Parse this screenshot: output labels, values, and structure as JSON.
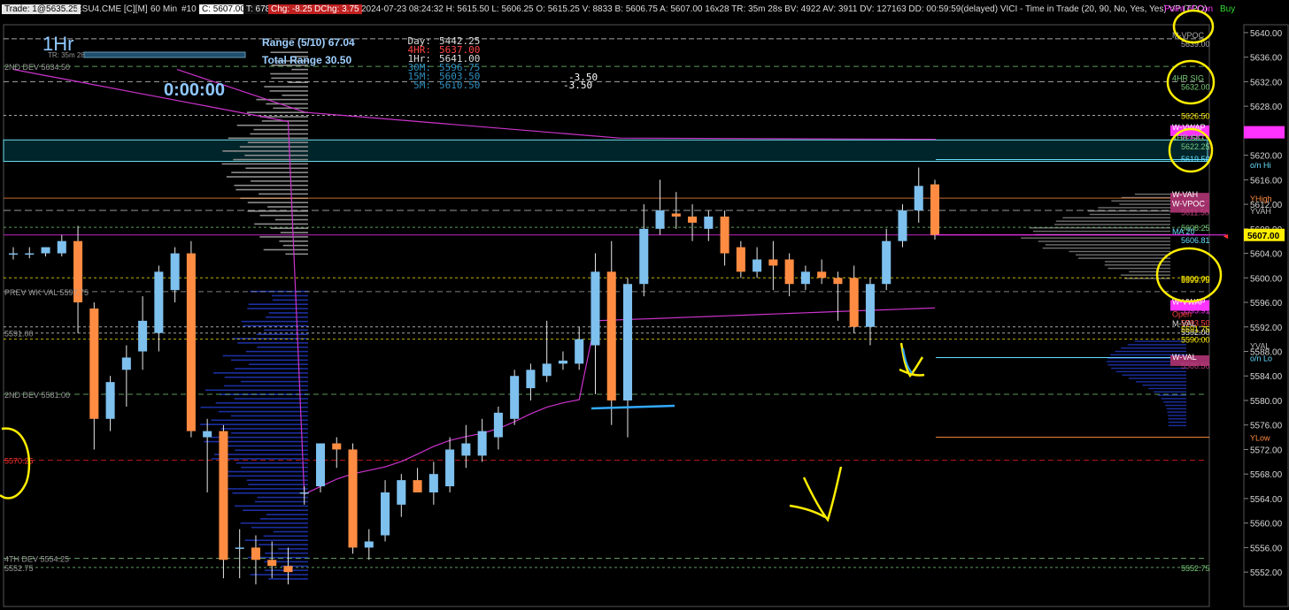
{
  "toolbar": {
    "trade_label": "Trade: 1@5635.25",
    "symbol": "ESU4.CME [C][M]",
    "interval": "60 Min",
    "bar_no": "#10",
    "close_chip": "C: 5607.00",
    "ticks": "T: 6783",
    "chg": "Chg: -8.25",
    "dchg": "DChg: 3.75",
    "info": "2024-07-23 08:24:32 H: 5615.50 L: 5606.25 O: 5615.25 V: 8833 B: 5606.75 A: 5607.00 16x28 TR: 35m 28s BV: 4922 AV: 3911 DV: 127163 DD: 00:59:59(delayed) VICI - Time in Trade (20, 90, No, Yes, Yes) VP (TPO)",
    "poi": "Point of Con",
    "buy": "Buy"
  },
  "panel": {
    "timeframe": "1Hr",
    "tr_label": "TR: 35m 28s",
    "countdown": "0:00:00",
    "range": "Range (5/10) 67.04",
    "total_range": "Total Range 30.50",
    "day": "Day:",
    "day_v": "5442.25",
    "h4": "4HR:",
    "h4_v": "5637.00",
    "h1": "1Hr:",
    "h1_v": "5641.00",
    "m30": "30M:",
    "m30_v": "5596.75",
    "m15": "15M:",
    "m15_v": "5603.50",
    "m5": "5M:",
    "m5_v": "5610.50",
    "delta1": "-3.50",
    "delta2": "-3.50"
  },
  "colors": {
    "up": "#7ec0ee",
    "down": "#ff8c42",
    "magenta": "#ff33ff",
    "annotation": "#ffee00",
    "green": "#7ccd7c"
  },
  "chart_data": {
    "type": "candlestick",
    "ylim": [
      5550,
      5641
    ],
    "y_ticks": [
      5640,
      5636,
      5632,
      5628,
      5624,
      5620,
      5616,
      5612,
      5608,
      5604,
      5600,
      5596,
      5592,
      5588,
      5584,
      5580,
      5576,
      5572,
      5568,
      5564,
      5560,
      5556,
      5552
    ],
    "y_tick_labels": [
      "5640.00",
      "5636.00",
      "5632.00",
      "5628.00",
      "5624.00",
      "5620.00",
      "5616.00",
      "5612.00",
      "5608.00",
      "5604.00",
      "5600.00",
      "5596.00",
      "5592.00",
      "5588.00",
      "5584.00",
      "5580.00",
      "5576.00",
      "5572.00",
      "5568.00",
      "5564.00",
      "5560.00",
      "5556.00",
      "5552.00"
    ],
    "last_price": "5607.00",
    "candles": [
      {
        "o": 5604.0,
        "h": 5605.0,
        "l": 5603.0,
        "c": 5604.0
      },
      {
        "o": 5604.0,
        "h": 5605.0,
        "l": 5603.2,
        "c": 5604.0
      },
      {
        "o": 5604.0,
        "h": 5605.0,
        "l": 5603.5,
        "c": 5605.0
      },
      {
        "o": 5604.0,
        "h": 5607.0,
        "l": 5603.5,
        "c": 5606.0
      },
      {
        "o": 5606.0,
        "h": 5608.5,
        "l": 5591.0,
        "c": 5596.0
      },
      {
        "o": 5595.0,
        "h": 5596.0,
        "l": 5572.0,
        "c": 5577.0
      },
      {
        "o": 5577.0,
        "h": 5584.0,
        "l": 5575.0,
        "c": 5583.0
      },
      {
        "o": 5585.0,
        "h": 5589.0,
        "l": 5579.0,
        "c": 5587.0
      },
      {
        "o": 5588.0,
        "h": 5597.0,
        "l": 5585.0,
        "c": 5593.0
      },
      {
        "o": 5591.0,
        "h": 5602.0,
        "l": 5588.0,
        "c": 5601.0
      },
      {
        "o": 5598.0,
        "h": 5605.0,
        "l": 5596.0,
        "c": 5604.0
      },
      {
        "o": 5604.0,
        "h": 5606.0,
        "l": 5574.0,
        "c": 5575.0
      },
      {
        "o": 5574.0,
        "h": 5577.0,
        "l": 5565.0,
        "c": 5575.0
      },
      {
        "o": 5575.0,
        "h": 5576.0,
        "l": 5551.0,
        "c": 5554.0
      },
      {
        "o": 5556.0,
        "h": 5559.0,
        "l": 5551.0,
        "c": 5556.0
      },
      {
        "o": 5556.0,
        "h": 5558.0,
        "l": 5550.0,
        "c": 5554.0
      },
      {
        "o": 5554.0,
        "h": 5557.0,
        "l": 5551.0,
        "c": 5553.0
      },
      {
        "o": 5553.0,
        "h": 5556.0,
        "l": 5550.0,
        "c": 5552.0
      },
      {
        "o": 5565.0,
        "h": 5566.0,
        "l": 5563.0,
        "c": 5565.0
      },
      {
        "o": 5566.0,
        "h": 5573.0,
        "l": 5565.0,
        "c": 5573.0
      },
      {
        "o": 5573.0,
        "h": 5574.0,
        "l": 5569.0,
        "c": 5572.0
      },
      {
        "o": 5572.0,
        "h": 5573.0,
        "l": 5555.0,
        "c": 5556.0
      },
      {
        "o": 5556.0,
        "h": 5559.0,
        "l": 5554.0,
        "c": 5557.0
      },
      {
        "o": 5558.0,
        "h": 5567.0,
        "l": 5557.0,
        "c": 5565.0
      },
      {
        "o": 5563.0,
        "h": 5568.0,
        "l": 5561.0,
        "c": 5567.0
      },
      {
        "o": 5567.0,
        "h": 5569.0,
        "l": 5565.0,
        "c": 5565.0
      },
      {
        "o": 5565.0,
        "h": 5570.0,
        "l": 5563.0,
        "c": 5568.0
      },
      {
        "o": 5566.0,
        "h": 5574.0,
        "l": 5565.0,
        "c": 5572.0
      },
      {
        "o": 5571.0,
        "h": 5576.0,
        "l": 5569.0,
        "c": 5573.0
      },
      {
        "o": 5571.0,
        "h": 5577.0,
        "l": 5570.0,
        "c": 5575.0
      },
      {
        "o": 5574.0,
        "h": 5579.0,
        "l": 5572.0,
        "c": 5578.0
      },
      {
        "o": 5577.0,
        "h": 5585.0,
        "l": 5576.0,
        "c": 5584.0
      },
      {
        "o": 5582.0,
        "h": 5586.0,
        "l": 5580.0,
        "c": 5585.0
      },
      {
        "o": 5584.0,
        "h": 5593.0,
        "l": 5583.0,
        "c": 5586.0
      },
      {
        "o": 5586.0,
        "h": 5588.0,
        "l": 5585.0,
        "c": 5586.5
      },
      {
        "o": 5586.0,
        "h": 5592.0,
        "l": 5585.0,
        "c": 5590.0
      },
      {
        "o": 5589.0,
        "h": 5604.0,
        "l": 5581.0,
        "c": 5601.0
      },
      {
        "o": 5601.0,
        "h": 5606.0,
        "l": 5576.0,
        "c": 5580.0
      },
      {
        "o": 5580.0,
        "h": 5600.0,
        "l": 5574.0,
        "c": 5599.0
      },
      {
        "o": 5599.0,
        "h": 5612.0,
        "l": 5597.0,
        "c": 5608.0
      },
      {
        "o": 5608.0,
        "h": 5616.0,
        "l": 5607.0,
        "c": 5611.0
      },
      {
        "o": 5610.5,
        "h": 5614.0,
        "l": 5608.0,
        "c": 5610.0
      },
      {
        "o": 5610.0,
        "h": 5612.0,
        "l": 5606.0,
        "c": 5609.0
      },
      {
        "o": 5608.0,
        "h": 5611.0,
        "l": 5606.0,
        "c": 5610.0
      },
      {
        "o": 5610.0,
        "h": 5611.0,
        "l": 5602.0,
        "c": 5604.0
      },
      {
        "o": 5605.0,
        "h": 5606.0,
        "l": 5600.0,
        "c": 5601.0
      },
      {
        "o": 5601.0,
        "h": 5605.0,
        "l": 5600.0,
        "c": 5603.0
      },
      {
        "o": 5603.0,
        "h": 5606.0,
        "l": 5598.0,
        "c": 5602.0
      },
      {
        "o": 5603.0,
        "h": 5604.0,
        "l": 5597.0,
        "c": 5599.0
      },
      {
        "o": 5599.0,
        "h": 5602.0,
        "l": 5598.0,
        "c": 5601.0
      },
      {
        "o": 5601.0,
        "h": 5603.0,
        "l": 5599.0,
        "c": 5600.0
      },
      {
        "o": 5600.0,
        "h": 5601.0,
        "l": 5593.0,
        "c": 5599.0
      },
      {
        "o": 5600.0,
        "h": 5602.0,
        "l": 5591.0,
        "c": 5592.0
      },
      {
        "o": 5592.0,
        "h": 5600.0,
        "l": 5589.0,
        "c": 5599.0
      },
      {
        "o": 5599.0,
        "h": 5608.0,
        "l": 5598.0,
        "c": 5606.0
      },
      {
        "o": 5606.0,
        "h": 5612.0,
        "l": 5605.0,
        "c": 5611.0
      },
      {
        "o": 5611.0,
        "h": 5618.0,
        "l": 5609.0,
        "c": 5615.0
      },
      {
        "o": 5615.25,
        "h": 5616.0,
        "l": 5606.25,
        "c": 5607.0
      }
    ],
    "levels": [
      {
        "price": 5639.0,
        "label": "M-VPOC",
        "value": "5639.00",
        "color": "#aaaaaa"
      },
      {
        "price": 5632.0,
        "label": "4HR SIG",
        "value": "5632.00",
        "color": "#7ccd7c"
      },
      {
        "price": 5626.5,
        "label": "",
        "value": "5626.50",
        "color": "#ffee00"
      },
      {
        "price": 5624.0,
        "label": "W-VWAP",
        "value": "5623.75",
        "color": "#ff33ff"
      },
      {
        "price": 5622.25,
        "label": "4HR SIG",
        "value": "5622.25",
        "color": "#7ccd7c"
      },
      {
        "price": 5619.5,
        "label": "",
        "value": "5619.50",
        "color": "#66ddff"
      },
      {
        "price": 5613.0,
        "label": "W-VAH",
        "value": "5613.00",
        "color": "#c04080"
      },
      {
        "price": 5611.5,
        "label": "W-VPOC",
        "value": "5611.50",
        "color": "#c04080"
      },
      {
        "price": 5608.25,
        "label": "",
        "value": "5608.25",
        "color": "#7ccd7c"
      },
      {
        "price": 5607.0,
        "label": "MA 20",
        "value": "5606.81",
        "color": "#66ddff"
      },
      {
        "price": 5600.0,
        "label": "",
        "value": "5600.00",
        "color": "#ffee00"
      },
      {
        "price": 5599.75,
        "label": "",
        "value": "5599.75",
        "color": "#ffee00"
      },
      {
        "price": 5595.5,
        "label": "W-VWAP",
        "value": "5595.91",
        "color": "#ff33ff"
      },
      {
        "price": 5593.5,
        "label": "Open",
        "value": "5593.50",
        "color": "#ff4444"
      },
      {
        "price": 5592.0,
        "label": "M-VAL",
        "value": "5592.00",
        "color": "#dddddd"
      },
      {
        "price": 5591.75,
        "label": "",
        "value": "5591.75",
        "color": "#ffee00"
      },
      {
        "price": 5590.0,
        "label": "",
        "value": "5590.00",
        "color": "#ffee00"
      },
      {
        "price": 5586.5,
        "label": "W-VAL",
        "value": "5586.50",
        "color": "#c04080"
      },
      {
        "price": 5552.75,
        "label": "",
        "value": "5552.75",
        "color": "#7ccd7c"
      }
    ],
    "left_labels": [
      {
        "price": 5634.5,
        "text": "2ND DEV  5634.50"
      },
      {
        "price": 5597.75,
        "text": "PREV WK VAL  5597.75"
      },
      {
        "price": 5591.0,
        "text": "5591.00"
      },
      {
        "price": 5581.0,
        "text": "2ND DEV  5581.00"
      },
      {
        "price": 5570.25,
        "text": "5570.25"
      },
      {
        "price": 5554.25,
        "text": "4TH DEV  5554.25"
      },
      {
        "price": 5552.75,
        "text": "5552.75"
      }
    ],
    "right_tags": [
      {
        "price": 5618.5,
        "text": "o/n Hi"
      },
      {
        "price": 5613.0,
        "text": "YHigh"
      },
      {
        "price": 5611.0,
        "text": "YVAH"
      },
      {
        "price": 5589.0,
        "text": "YVAL"
      },
      {
        "price": 5587.0,
        "text": "o/n Lo"
      },
      {
        "price": 5574.0,
        "text": "YLow"
      }
    ]
  }
}
